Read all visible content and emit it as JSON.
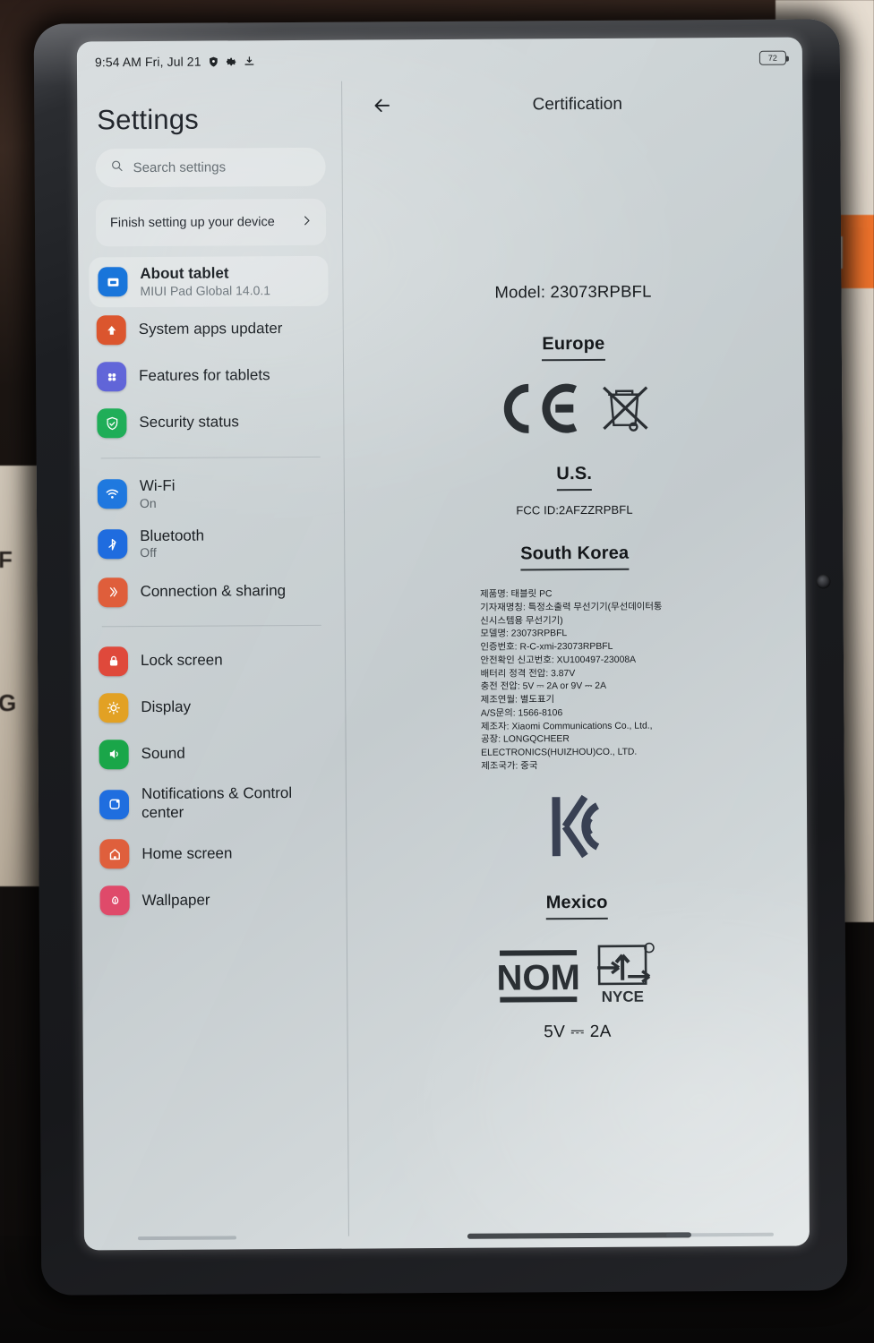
{
  "status_bar": {
    "time_date": "9:54 AM Fri, Jul 21",
    "icons": [
      "shield-icon",
      "gear-icon",
      "download-icon"
    ],
    "battery_percent": "72"
  },
  "sidebar": {
    "title": "Settings",
    "search": {
      "placeholder": "Search settings",
      "icon": "search-icon"
    },
    "finish_setup": {
      "label": "Finish setting up your device",
      "chevron": "chevron-right-icon"
    },
    "items": [
      {
        "label": "About tablet",
        "sub": "MIUI Pad Global 14.0.1",
        "icon": "tablet-icon",
        "color": "#1669d6",
        "selected": true
      },
      {
        "label": "System apps updater",
        "sub": "",
        "icon": "up-arrow-icon",
        "color": "#d84e2a",
        "selected": false
      },
      {
        "label": "Features for tablets",
        "sub": "",
        "icon": "four-dots-icon",
        "color": "#5b5fd6",
        "selected": false
      },
      {
        "label": "Security status",
        "sub": "",
        "icon": "shield-check-icon",
        "color": "#1eab55",
        "selected": false
      },
      {
        "label": "Wi-Fi",
        "sub": "On",
        "icon": "wifi-icon",
        "color": "#1f7ae0",
        "selected": false
      },
      {
        "label": "Bluetooth",
        "sub": "Off",
        "icon": "bluetooth-icon",
        "color": "#1f6fe0",
        "selected": false
      },
      {
        "label": "Connection & sharing",
        "sub": "",
        "icon": "connection-sharing-icon",
        "color": "#e0603c",
        "selected": false
      },
      {
        "label": "Lock screen",
        "sub": "",
        "icon": "lock-icon",
        "color": "#e04a3c",
        "selected": false
      },
      {
        "label": "Display",
        "sub": "",
        "icon": "brightness-icon",
        "color": "#e3a324",
        "selected": false
      },
      {
        "label": "Sound",
        "sub": "",
        "icon": "speaker-icon",
        "color": "#1aa84a",
        "selected": false
      },
      {
        "label": "Notifications & Control center",
        "sub": "",
        "icon": "notifications-icon",
        "color": "#1f6fe0",
        "selected": false
      },
      {
        "label": "Home screen",
        "sub": "",
        "icon": "home-icon",
        "color": "#e0603c",
        "selected": false
      },
      {
        "label": "Wallpaper",
        "sub": "",
        "icon": "flower-icon",
        "color": "#e04a6b",
        "selected": false
      }
    ]
  },
  "detail": {
    "back_icon": "back-arrow-icon",
    "title": "Certification",
    "model_line": "Model: 23073RPBFL",
    "regions": {
      "europe": {
        "heading": "Europe",
        "marks": [
          "ce-mark-icon",
          "weee-bin-icon"
        ]
      },
      "us": {
        "heading": "U.S.",
        "fcc_id": "FCC ID:2AFZZRPBFL"
      },
      "south_korea": {
        "heading": "South Korea",
        "lines": [
          "제품명: 태블릿 PC",
          "기자재명칭: 특정소출력 무선기기(무선데이터통신시스템용 무선기기)",
          "모델명: 23073RPBFL",
          "인증번호: R-C-xmi-23073RPBFL",
          "안전확인 신고번호: XU100497-23008A",
          "배터리 정격 전압: 3.87V",
          "충전 전압: 5V ⎓ 2A or 9V ⎓ 2A",
          "제조연월: 별도표기",
          "A/S문의: 1566-8106",
          "제조자: Xiaomi Communications Co., Ltd.,",
          "공장: LONGQCHEER ELECTRONICS(HUIZHOU)CO., LTD.",
          "제조국가: 중국"
        ],
        "mark": "kc-mark-icon"
      },
      "mexico": {
        "heading": "Mexico",
        "marks": [
          "nom-mark-icon",
          "nyce-mark-icon"
        ],
        "nyce_label": "NYCE",
        "nom_label": "NOM",
        "rating": "5V ⎓ 2A"
      }
    }
  },
  "background": {
    "left_box_text_1": "F",
    "left_box_text_2": "G",
    "brand_logo": "mi-logo-icon"
  }
}
